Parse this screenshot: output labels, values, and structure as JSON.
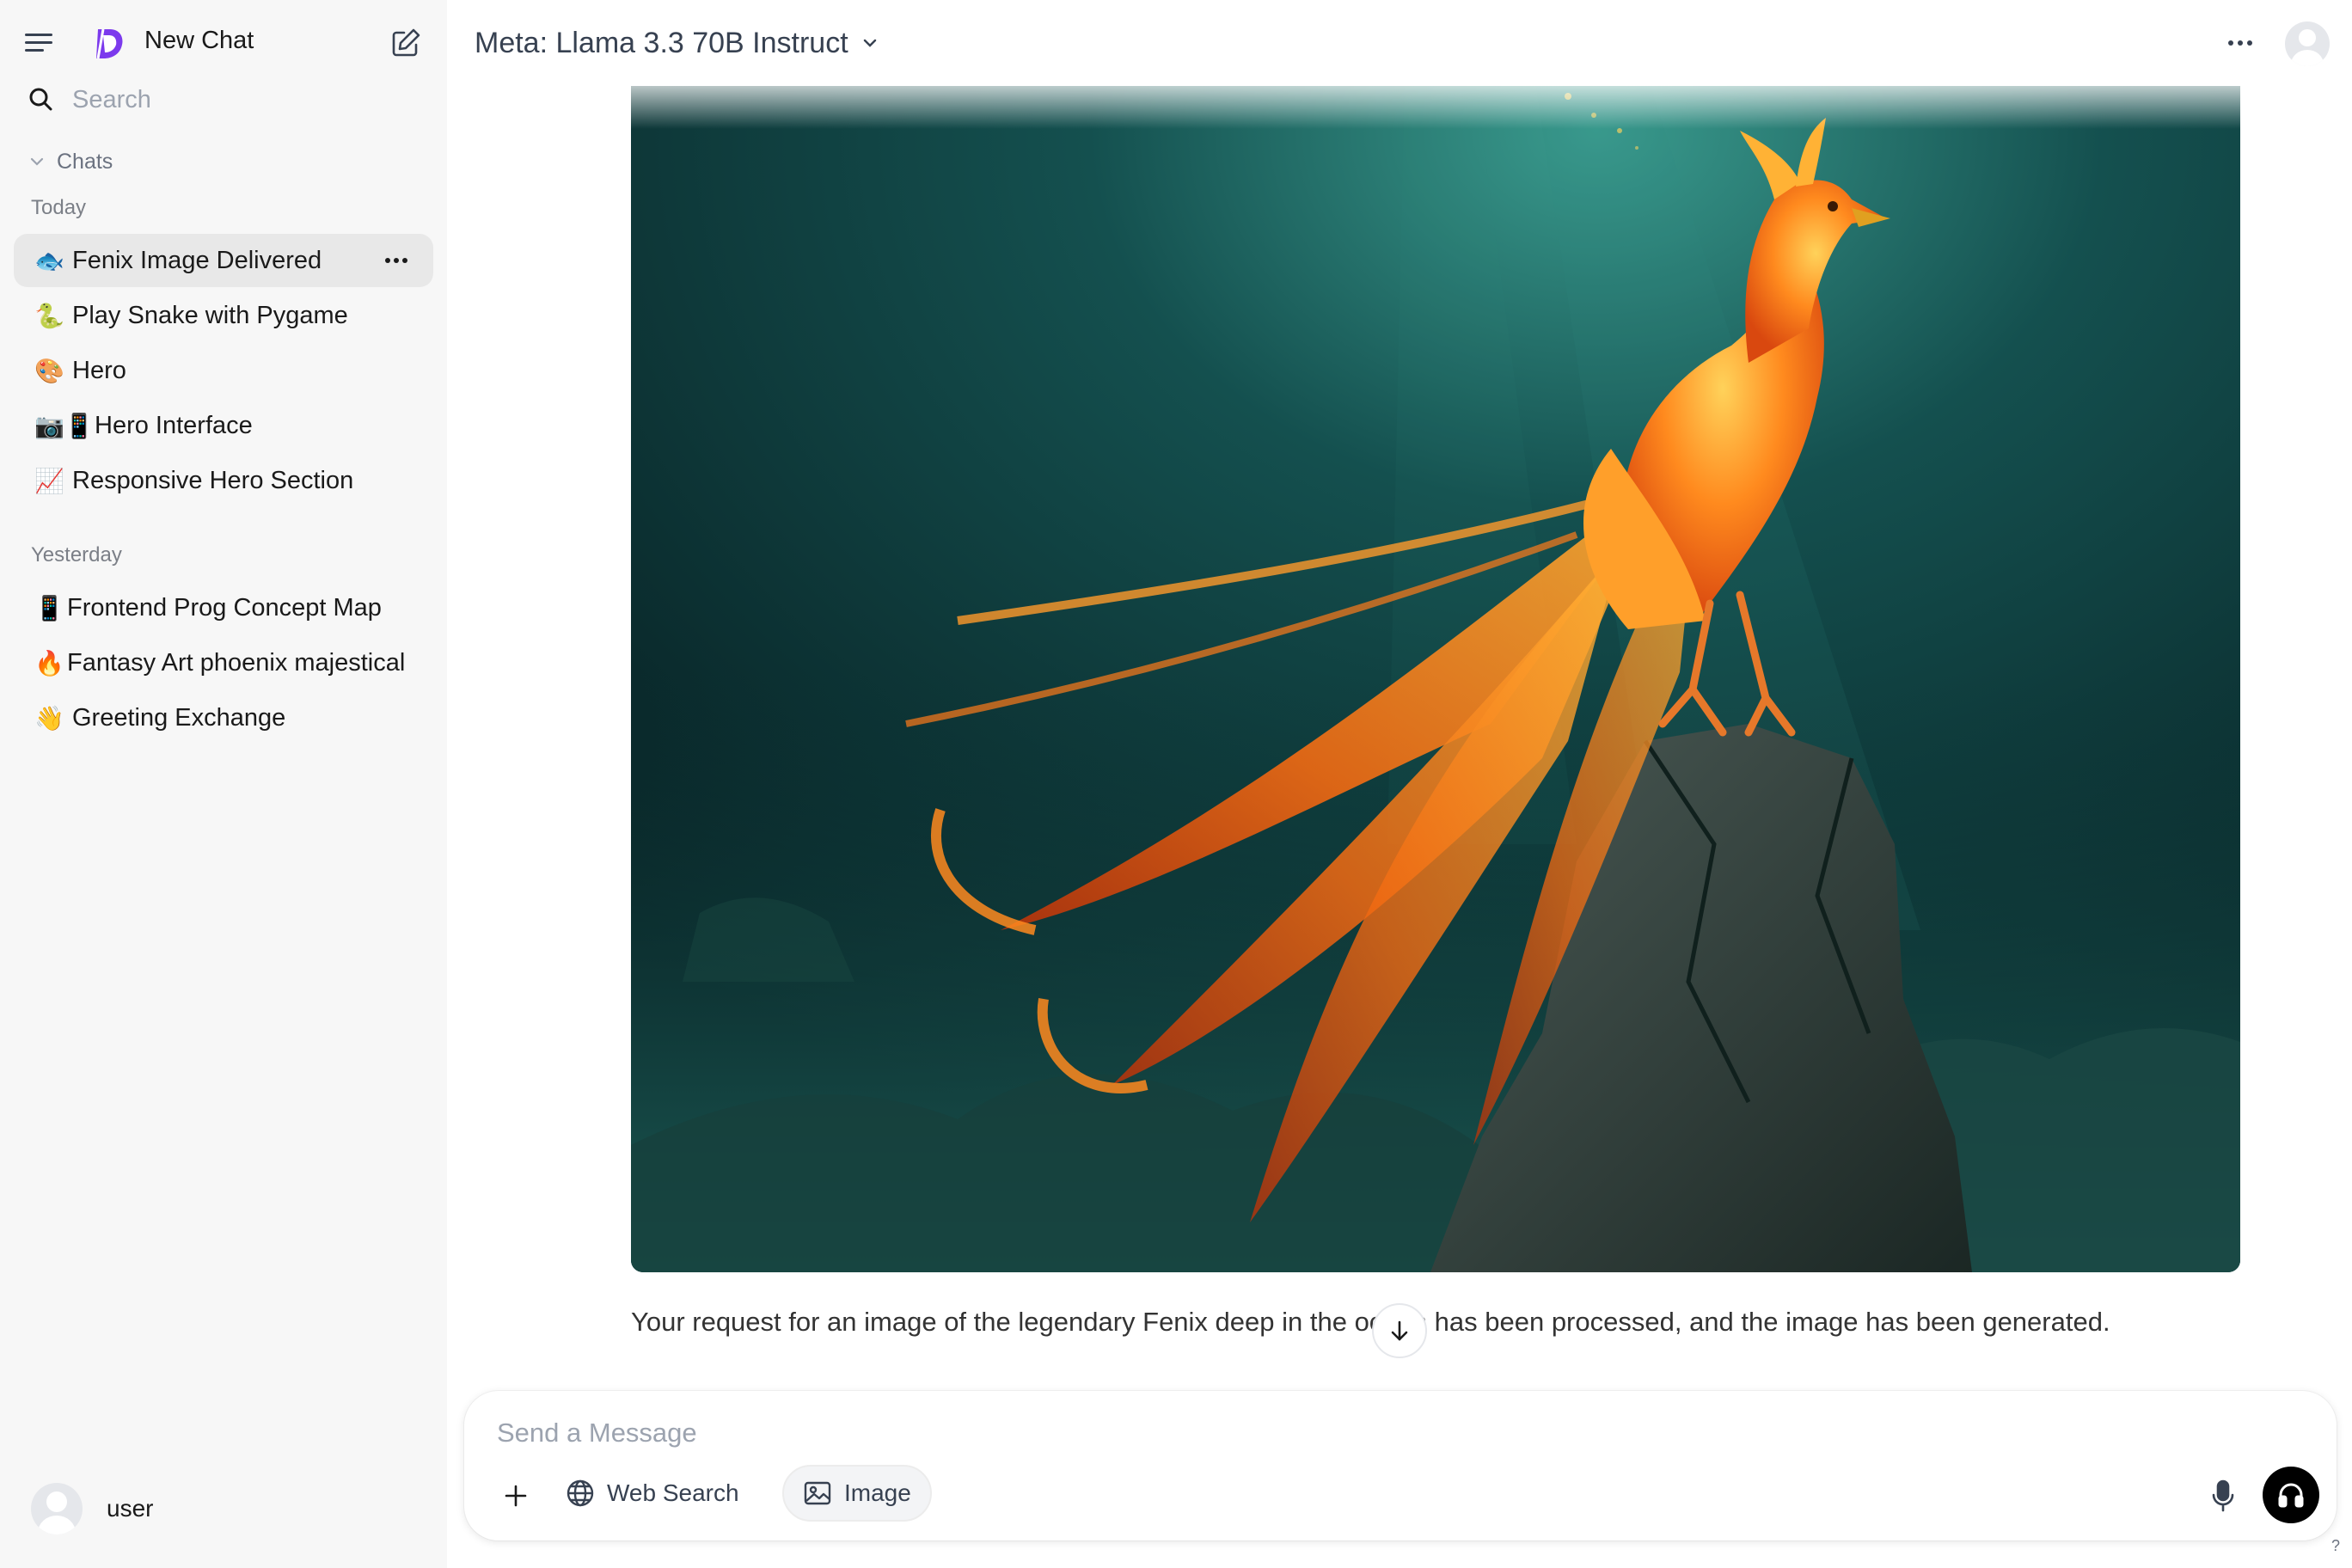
{
  "sidebar": {
    "new_chat_label": "New Chat",
    "search_placeholder": "Search",
    "chats_label": "Chats",
    "groups": [
      {
        "label": "Today",
        "items": [
          {
            "emoji": "🐟",
            "title": "Fenix Image Delivered",
            "active": true
          },
          {
            "emoji": "🐍",
            "title": "Play Snake with Pygame"
          },
          {
            "emoji": "🎨",
            "title": "Hero"
          },
          {
            "emoji": "📷📱",
            "title": "Hero Interface"
          },
          {
            "emoji": "📈",
            "title": "Responsive Hero Section"
          }
        ]
      },
      {
        "label": "Yesterday",
        "items": [
          {
            "emoji": "📱",
            "title": "Frontend Prog Concept Map"
          },
          {
            "emoji": "🔥",
            "title": "Fantasy Art phoenix majestical"
          },
          {
            "emoji": "👋",
            "title": "Greeting Exchange"
          }
        ]
      }
    ],
    "user_name": "user"
  },
  "header": {
    "model_name": "Meta: Llama 3.3 70B Instruct"
  },
  "message": {
    "text": "Your request for an image of the legendary Fenix deep in the ocean has been processed, and the image has been generated."
  },
  "composer": {
    "placeholder": "Send a Message",
    "web_search_label": "Web Search",
    "image_label": "Image"
  },
  "help_label": "?",
  "colors": {
    "accent_logo": "#7c3aed",
    "sidebar_bg": "#f7f7f7",
    "active_item_bg": "#e8e8e8",
    "ocean_deep": "#0b2a2c",
    "ocean_light": "#1f6f6a",
    "phoenix_orange": "#f26a12"
  }
}
